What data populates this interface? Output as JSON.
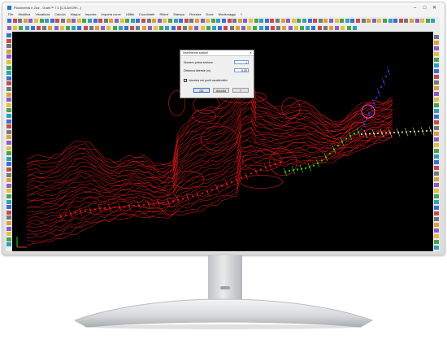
{
  "window": {
    "title": "Planimetria e Zizz - Grafx™ 7.0 [C:\\LAVORI\\...]",
    "minimize": "–",
    "maximize": "□",
    "close": "✕"
  },
  "menu": [
    "File",
    "Modifica",
    "Visualizza",
    "Calcola",
    "Mappa",
    "Importa",
    "Importa curve",
    "Utilità",
    "Coordinate",
    "Rilievi",
    "Stampa",
    "Finestra",
    "Dove",
    "Monitoraggi",
    "?"
  ],
  "dialog": {
    "title": "Inserimento sezioni",
    "close": "✕",
    "field1_label": "Numero prima sezione",
    "field1_value": "1",
    "field2_label": "Distanza laterale (m)",
    "field2_value": "5,00",
    "checkbox_label": "Inserisci nei punti caratteristici",
    "ok_label": "OK",
    "cancel_label": "Annulla",
    "help_label": "?"
  },
  "colors": {
    "terrain": "#e01818",
    "alignment_green": "#22dd22",
    "alignment_blue": "#2f3fe0",
    "alignment_pink": "#ee44cc",
    "alignment_cream": "#ddd3a0",
    "axes_x": "#ff2020",
    "axes_y": "#20dd20"
  },
  "icons": [
    "new-icon",
    "open-icon",
    "save-icon",
    "print-icon",
    "undo-icon",
    "redo-icon",
    "zoom-icon",
    "pan-icon",
    "select-icon",
    "layer-icon",
    "settings-icon",
    "help-icon"
  ]
}
